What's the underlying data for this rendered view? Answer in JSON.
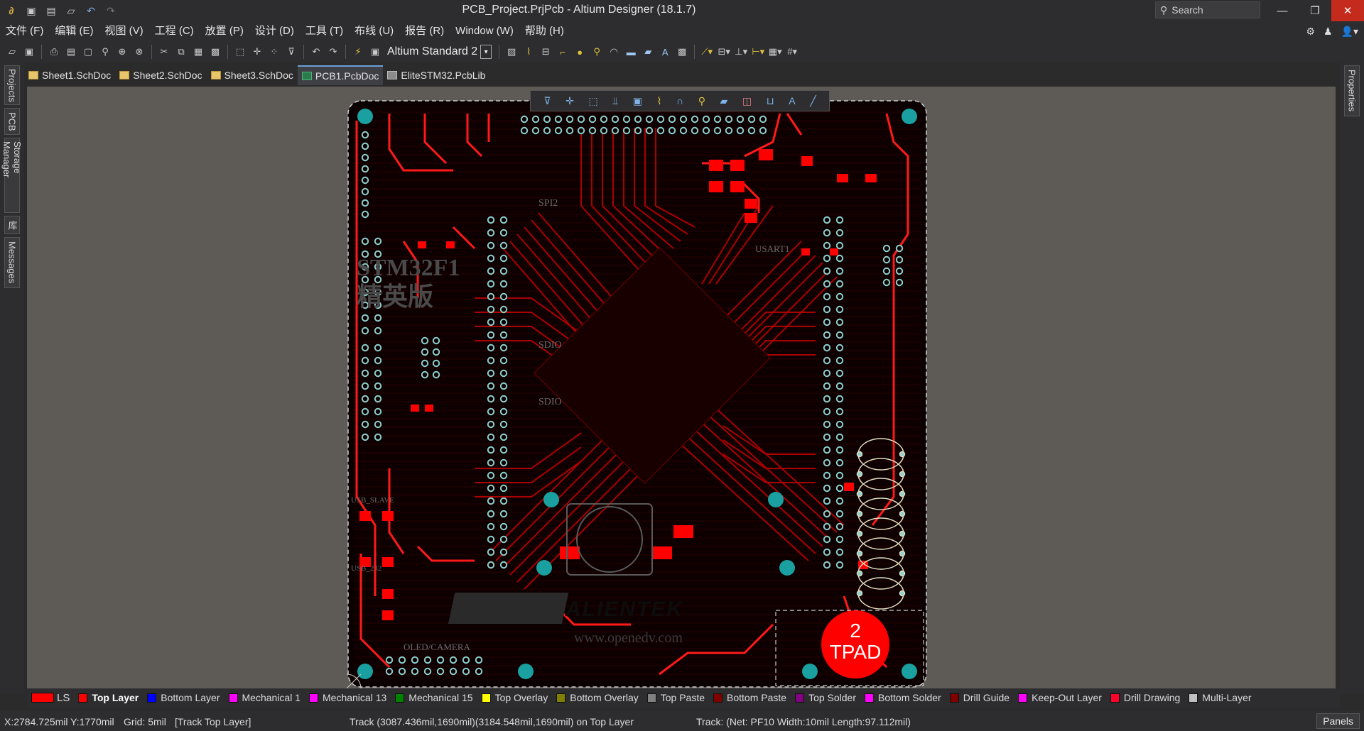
{
  "window": {
    "title": "PCB_Project.PrjPcb - Altium Designer (18.1.7)",
    "search_placeholder": "Search"
  },
  "menu": [
    "文件 (F)",
    "编辑 (E)",
    "视图 (V)",
    "工程 (C)",
    "放置 (P)",
    "设计 (D)",
    "工具 (T)",
    "布线 (U)",
    "报告 (R)",
    "Window (W)",
    "帮助 (H)"
  ],
  "toolbar": {
    "view_config": "Altium Standard 2"
  },
  "left_panels": [
    "Projects",
    "PCB",
    "Storage Manager",
    "库",
    "Messages"
  ],
  "right_panels": [
    "Properties"
  ],
  "doc_tabs": [
    {
      "label": "Sheet1.SchDoc",
      "kind": "sch"
    },
    {
      "label": "Sheet2.SchDoc",
      "kind": "sch"
    },
    {
      "label": "Sheet3.SchDoc",
      "kind": "sch"
    },
    {
      "label": "PCB1.PcbDoc",
      "kind": "pcb",
      "active": true
    },
    {
      "label": "EliteSTM32.PcbLib",
      "kind": "lib"
    }
  ],
  "board": {
    "silk_main": "STM32F1",
    "silk_sub": "精英版",
    "brand": "ALIENTEK",
    "url": "www.openedv.com",
    "net_labels": [
      "SPI2",
      "SDIO",
      "SDIO",
      "USART1",
      "OLED/CAMERA",
      "USB_SLAVE",
      "USB_232"
    ],
    "pad_number": "2",
    "pad_label": "TPAD"
  },
  "layers": [
    {
      "name": "Top Layer",
      "color": "#ff0000",
      "active": true
    },
    {
      "name": "Bottom Layer",
      "color": "#0000ff"
    },
    {
      "name": "Mechanical 1",
      "color": "#ff00ff"
    },
    {
      "name": "Mechanical 13",
      "color": "#ff00ff"
    },
    {
      "name": "Mechanical 15",
      "color": "#008000"
    },
    {
      "name": "Top Overlay",
      "color": "#ffff00"
    },
    {
      "name": "Bottom Overlay",
      "color": "#808000"
    },
    {
      "name": "Top Paste",
      "color": "#808080"
    },
    {
      "name": "Bottom Paste",
      "color": "#800000"
    },
    {
      "name": "Top Solder",
      "color": "#800080"
    },
    {
      "name": "Bottom Solder",
      "color": "#ff00ff"
    },
    {
      "name": "Drill Guide",
      "color": "#800000"
    },
    {
      "name": "Keep-Out Layer",
      "color": "#ff00ff"
    },
    {
      "name": "Drill Drawing",
      "color": "#ff002a"
    },
    {
      "name": "Multi-Layer",
      "color": "#c0c0c0"
    }
  ],
  "ls_label": "LS",
  "status": {
    "coords": "X:2784.725mil Y:1770mil",
    "grid": "Grid: 5mil",
    "mode": "[Track Top Layer]",
    "track": "Track (3087.436mil,1690mil)(3184.548mil,1690mil) on Top Layer",
    "net": "Track: (Net: PF10 Width:10mil Length:97.112mil)",
    "panels": "Panels"
  }
}
